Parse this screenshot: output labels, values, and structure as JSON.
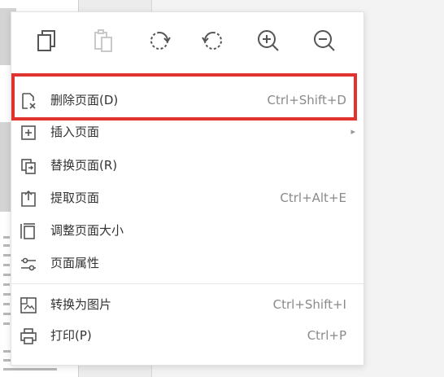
{
  "colors": {
    "highlight": "#e0322e",
    "label": "#333333",
    "shortcut": "#8a8a8a",
    "icon": "#555555"
  },
  "toolbar": [
    {
      "name": "copy-page-button",
      "icon": "copy-icon",
      "enabled": true
    },
    {
      "name": "paste-page-button",
      "icon": "paste-icon",
      "enabled": false
    },
    {
      "name": "rotate-clockwise-button",
      "icon": "rotate-clockwise-icon",
      "enabled": true
    },
    {
      "name": "rotate-counterclockwise-button",
      "icon": "rotate-counterclockwise-icon",
      "enabled": true
    },
    {
      "name": "zoom-in-button",
      "icon": "zoom-in-icon",
      "enabled": true
    },
    {
      "name": "zoom-out-button",
      "icon": "zoom-out-icon",
      "enabled": true
    }
  ],
  "menu": {
    "items": [
      {
        "label": "删除页面(D)",
        "shortcut": "Ctrl+Shift+D",
        "icon": "delete-page-icon",
        "highlighted": true
      },
      {
        "label": "插入页面",
        "shortcut": "",
        "icon": "insert-page-icon",
        "submenu": true
      },
      {
        "label": "替换页面(R)",
        "shortcut": "",
        "icon": "replace-page-icon"
      },
      {
        "label": "提取页面",
        "shortcut": "Ctrl+Alt+E",
        "icon": "extract-page-icon"
      },
      {
        "label": "调整页面大小",
        "shortcut": "",
        "icon": "resize-page-icon"
      },
      {
        "label": "页面属性",
        "shortcut": "",
        "icon": "page-properties-icon"
      },
      {
        "label": "转换为图片",
        "shortcut": "Ctrl+Shift+I",
        "icon": "convert-to-image-icon"
      },
      {
        "label": "打印(P)",
        "shortcut": "Ctrl+P",
        "icon": "print-icon"
      }
    ],
    "submenu_arrow": "▸"
  }
}
